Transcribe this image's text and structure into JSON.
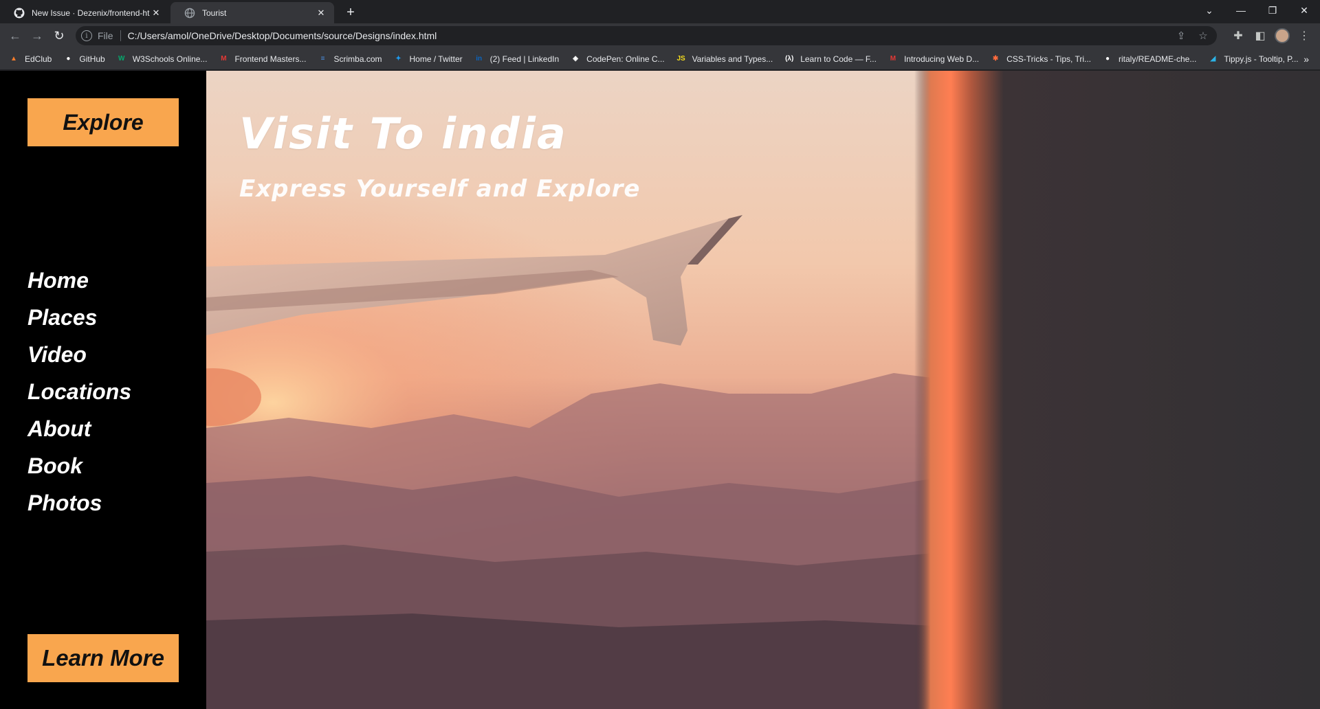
{
  "browser": {
    "tabs": [
      {
        "title": "New Issue · Dezenix/frontend-ht",
        "icon": "github-icon",
        "active": false
      },
      {
        "title": "Tourist",
        "icon": "globe-icon",
        "active": true
      }
    ],
    "address": {
      "scheme": "File",
      "url": "C:/Users/amol/OneDrive/Desktop/Documents/source/Designs/index.html"
    },
    "bookmarks": [
      {
        "label": "EdClub",
        "icon": "edclub-icon",
        "color": "#f57c2b",
        "glyph": "▲"
      },
      {
        "label": "GitHub",
        "icon": "github-icon",
        "color": "#ffffff",
        "glyph": "●"
      },
      {
        "label": "W3Schools Online...",
        "icon": "w3schools-icon",
        "color": "#04aa6d",
        "glyph": "W"
      },
      {
        "label": "Frontend Masters...",
        "icon": "frontendmasters-icon",
        "color": "#e53935",
        "glyph": "M"
      },
      {
        "label": "Scrimba.com",
        "icon": "scrimba-icon",
        "color": "#4a90e2",
        "glyph": "≡"
      },
      {
        "label": "Home / Twitter",
        "icon": "twitter-icon",
        "color": "#1d9bf0",
        "glyph": "✦"
      },
      {
        "label": "(2) Feed | LinkedIn",
        "icon": "linkedin-icon",
        "color": "#0a66c2",
        "glyph": "in"
      },
      {
        "label": "CodePen: Online C...",
        "icon": "codepen-icon",
        "color": "#ffffff",
        "glyph": "◈"
      },
      {
        "label": "Variables and Types...",
        "icon": "js-icon",
        "color": "#f7df1e",
        "glyph": "JS"
      },
      {
        "label": "Learn to Code — F...",
        "icon": "freecodecamp-icon",
        "color": "#ffffff",
        "glyph": "(λ)"
      },
      {
        "label": "Introducing Web D...",
        "icon": "frontendmasters-icon",
        "color": "#e53935",
        "glyph": "M"
      },
      {
        "label": "CSS-Tricks - Tips, Tri...",
        "icon": "csstricks-icon",
        "color": "#ff6b3d",
        "glyph": "✱"
      },
      {
        "label": "ritaly/README-che...",
        "icon": "github-icon",
        "color": "#ffffff",
        "glyph": "●"
      },
      {
        "label": "Tippy.js - Tooltip, P...",
        "icon": "tippy-icon",
        "color": "#2bb3e6",
        "glyph": "◢"
      }
    ],
    "more_label": "»"
  },
  "sidebar": {
    "explore_label": "Explore",
    "nav": [
      "Home",
      "Places",
      "Video",
      "Locations",
      "About",
      "Book",
      "Photos"
    ],
    "learn_more_label": "Learn More"
  },
  "hero": {
    "title": "Visit To india",
    "subtitle": "Express Yourself and Explore"
  },
  "colors": {
    "accent": "#f9a64e",
    "sidebar_bg": "#000000",
    "chrome_dark": "#202124",
    "chrome_toolbar": "#35363a"
  }
}
